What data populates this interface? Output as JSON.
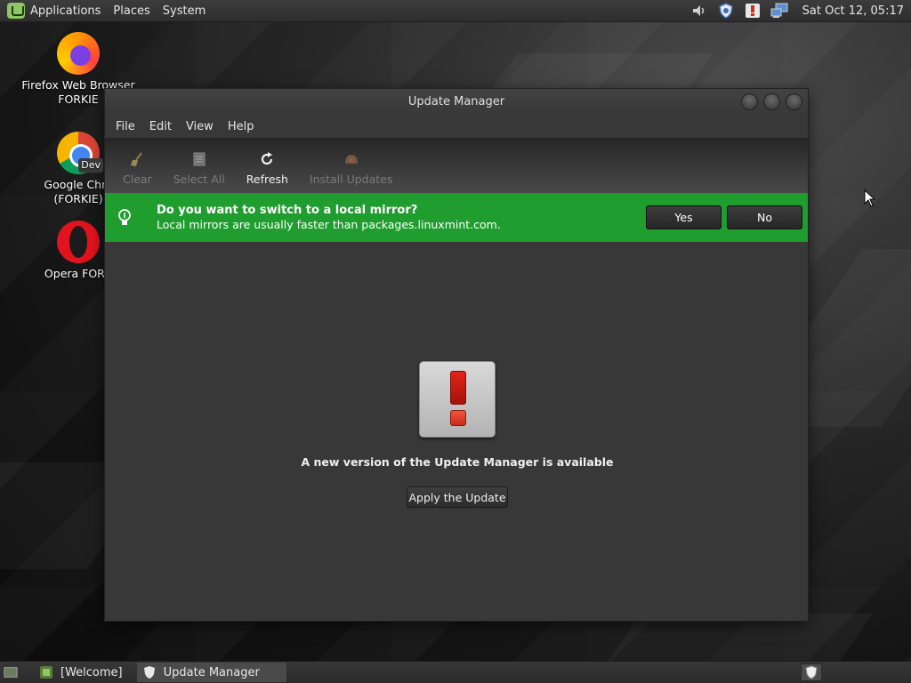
{
  "top_panel": {
    "menus": [
      "Applications",
      "Places",
      "System"
    ],
    "clock": "Sat Oct 12, 05:17",
    "tray_icons": [
      "volume-icon",
      "shield-update-icon",
      "alert-icon",
      "network-icon"
    ]
  },
  "desktop": {
    "icons": [
      {
        "line1": "Firefox Web Browser",
        "line2": "FORKIE",
        "icon": "firefox-icon"
      },
      {
        "line1": "Google Chro",
        "line2": "(FORKIE)",
        "icon": "chrome-dev-icon",
        "badge": "Dev"
      },
      {
        "line1": "Opera FORK",
        "line2": "",
        "icon": "opera-icon"
      }
    ]
  },
  "window": {
    "title": "Update Manager",
    "menu": [
      "File",
      "Edit",
      "View",
      "Help"
    ],
    "toolbar": [
      {
        "label": "Clear",
        "icon": "broom-icon",
        "enabled": false
      },
      {
        "label": "Select All",
        "icon": "select-all-icon",
        "enabled": false
      },
      {
        "label": "Refresh",
        "icon": "refresh-icon",
        "enabled": true
      },
      {
        "label": "Install Updates",
        "icon": "install-icon",
        "enabled": false
      }
    ],
    "infobar": {
      "title": "Do you want to switch to a local mirror?",
      "subtitle": "Local mirrors are usually faster than packages.linuxmint.com.",
      "yes": "Yes",
      "no": "No",
      "color": "#1f9d2e"
    },
    "content": {
      "message": "A new version of the Update Manager is available",
      "button": "Apply the Update"
    }
  },
  "bottom_panel": {
    "tasks": [
      {
        "label": "[Welcome]",
        "active": false
      },
      {
        "label": "Update Manager",
        "active": true
      }
    ]
  }
}
